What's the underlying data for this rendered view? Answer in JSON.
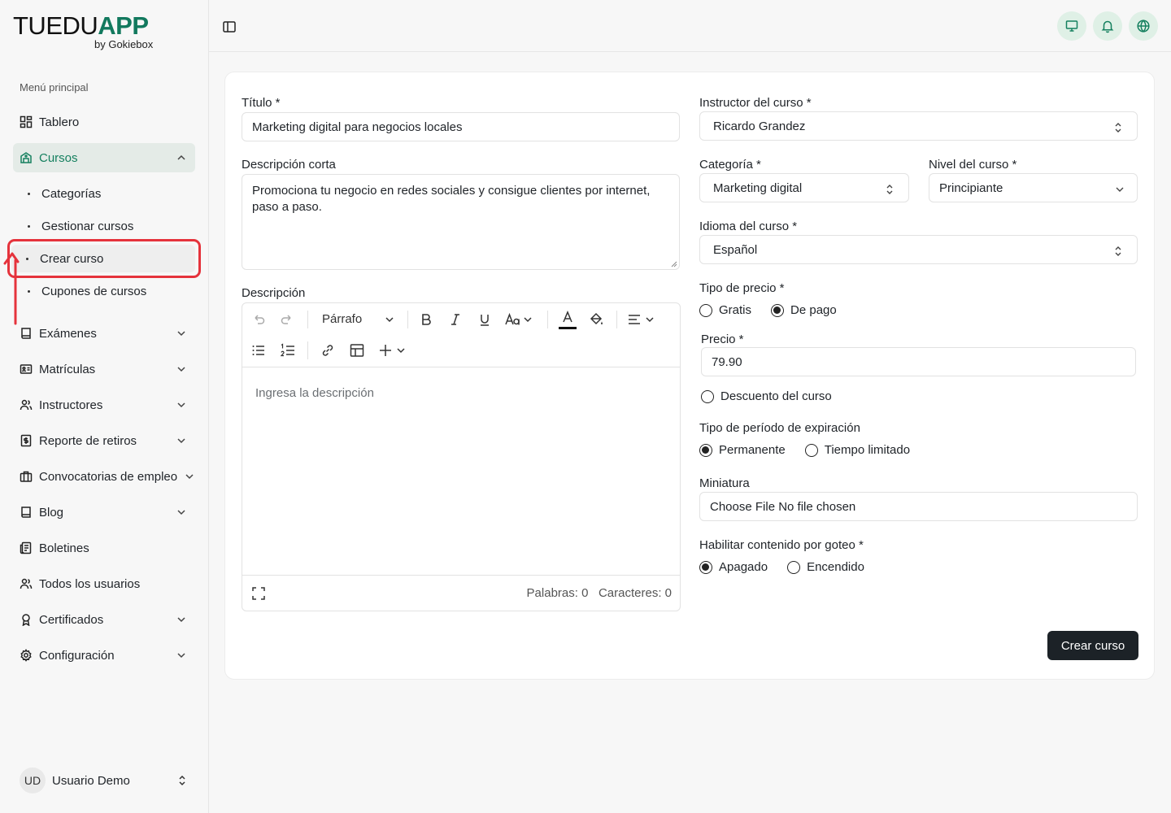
{
  "brand": {
    "logo_main": "TUEDU",
    "logo_app": "APP",
    "logo_sub": "by Gokiebox"
  },
  "sidebar": {
    "menu_title": "Menú principal",
    "items": [
      {
        "label": "Tablero",
        "icon": "dashboard-icon"
      },
      {
        "label": "Cursos",
        "icon": "courses-icon",
        "expanded": true
      },
      {
        "label": "Exámenes",
        "icon": "book-icon"
      },
      {
        "label": "Matrículas",
        "icon": "enrollment-icon"
      },
      {
        "label": "Instructores",
        "icon": "users-icon"
      },
      {
        "label": "Reporte de retiros",
        "icon": "receipt-icon"
      },
      {
        "label": "Convocatorias de empleo",
        "icon": "briefcase-icon"
      },
      {
        "label": "Blog",
        "icon": "book-icon"
      },
      {
        "label": "Boletines",
        "icon": "newsletter-icon"
      },
      {
        "label": "Todos los usuarios",
        "icon": "users-icon"
      },
      {
        "label": "Certificados",
        "icon": "award-icon"
      },
      {
        "label": "Configuración",
        "icon": "gear-icon"
      }
    ],
    "sub_items": [
      "Categorías",
      "Gestionar cursos",
      "Crear curso",
      "Cupones de cursos"
    ],
    "user": {
      "initials": "UD",
      "name": "Usuario Demo"
    }
  },
  "form": {
    "title_label": "Título *",
    "title_value": "Marketing digital para negocios locales",
    "short_desc_label": "Descripción corta",
    "short_desc_value": "Promociona tu negocio en redes sociales y consigue clientes por internet, paso a paso.",
    "desc_label": "Descripción",
    "editor": {
      "paragraph": "Párrafo",
      "placeholder": "Ingresa la descripción",
      "words": "Palabras: 0",
      "chars": "Caracteres: 0"
    },
    "instructor_label": "Instructor del curso *",
    "instructor_value": "Ricardo Grandez",
    "category_label": "Categoría *",
    "category_value": "Marketing digital",
    "level_label": "Nivel del curso *",
    "level_value": "Principiante",
    "language_label": "Idioma del curso *",
    "language_value": "Español",
    "price_type_label": "Tipo de precio *",
    "price_type_options": [
      "Gratis",
      "De pago"
    ],
    "price_type_selected": "De pago",
    "price_label": "Precio *",
    "price_value": "79.90",
    "discount_label": "Descuento del curso",
    "expiry_label": "Tipo de período de expiración",
    "expiry_options": [
      "Permanente",
      "Tiempo limitado"
    ],
    "expiry_selected": "Permanente",
    "thumb_label": "Miniatura",
    "file_button": "Choose File",
    "file_status": "No file chosen",
    "drip_label": "Habilitar contenido por goteo *",
    "drip_options": [
      "Apagado",
      "Encendido"
    ],
    "drip_selected": "Apagado",
    "submit": "Crear curso"
  },
  "colors": {
    "accent": "#15805f",
    "highlight": "#e5333c",
    "button": "#1c2227"
  }
}
